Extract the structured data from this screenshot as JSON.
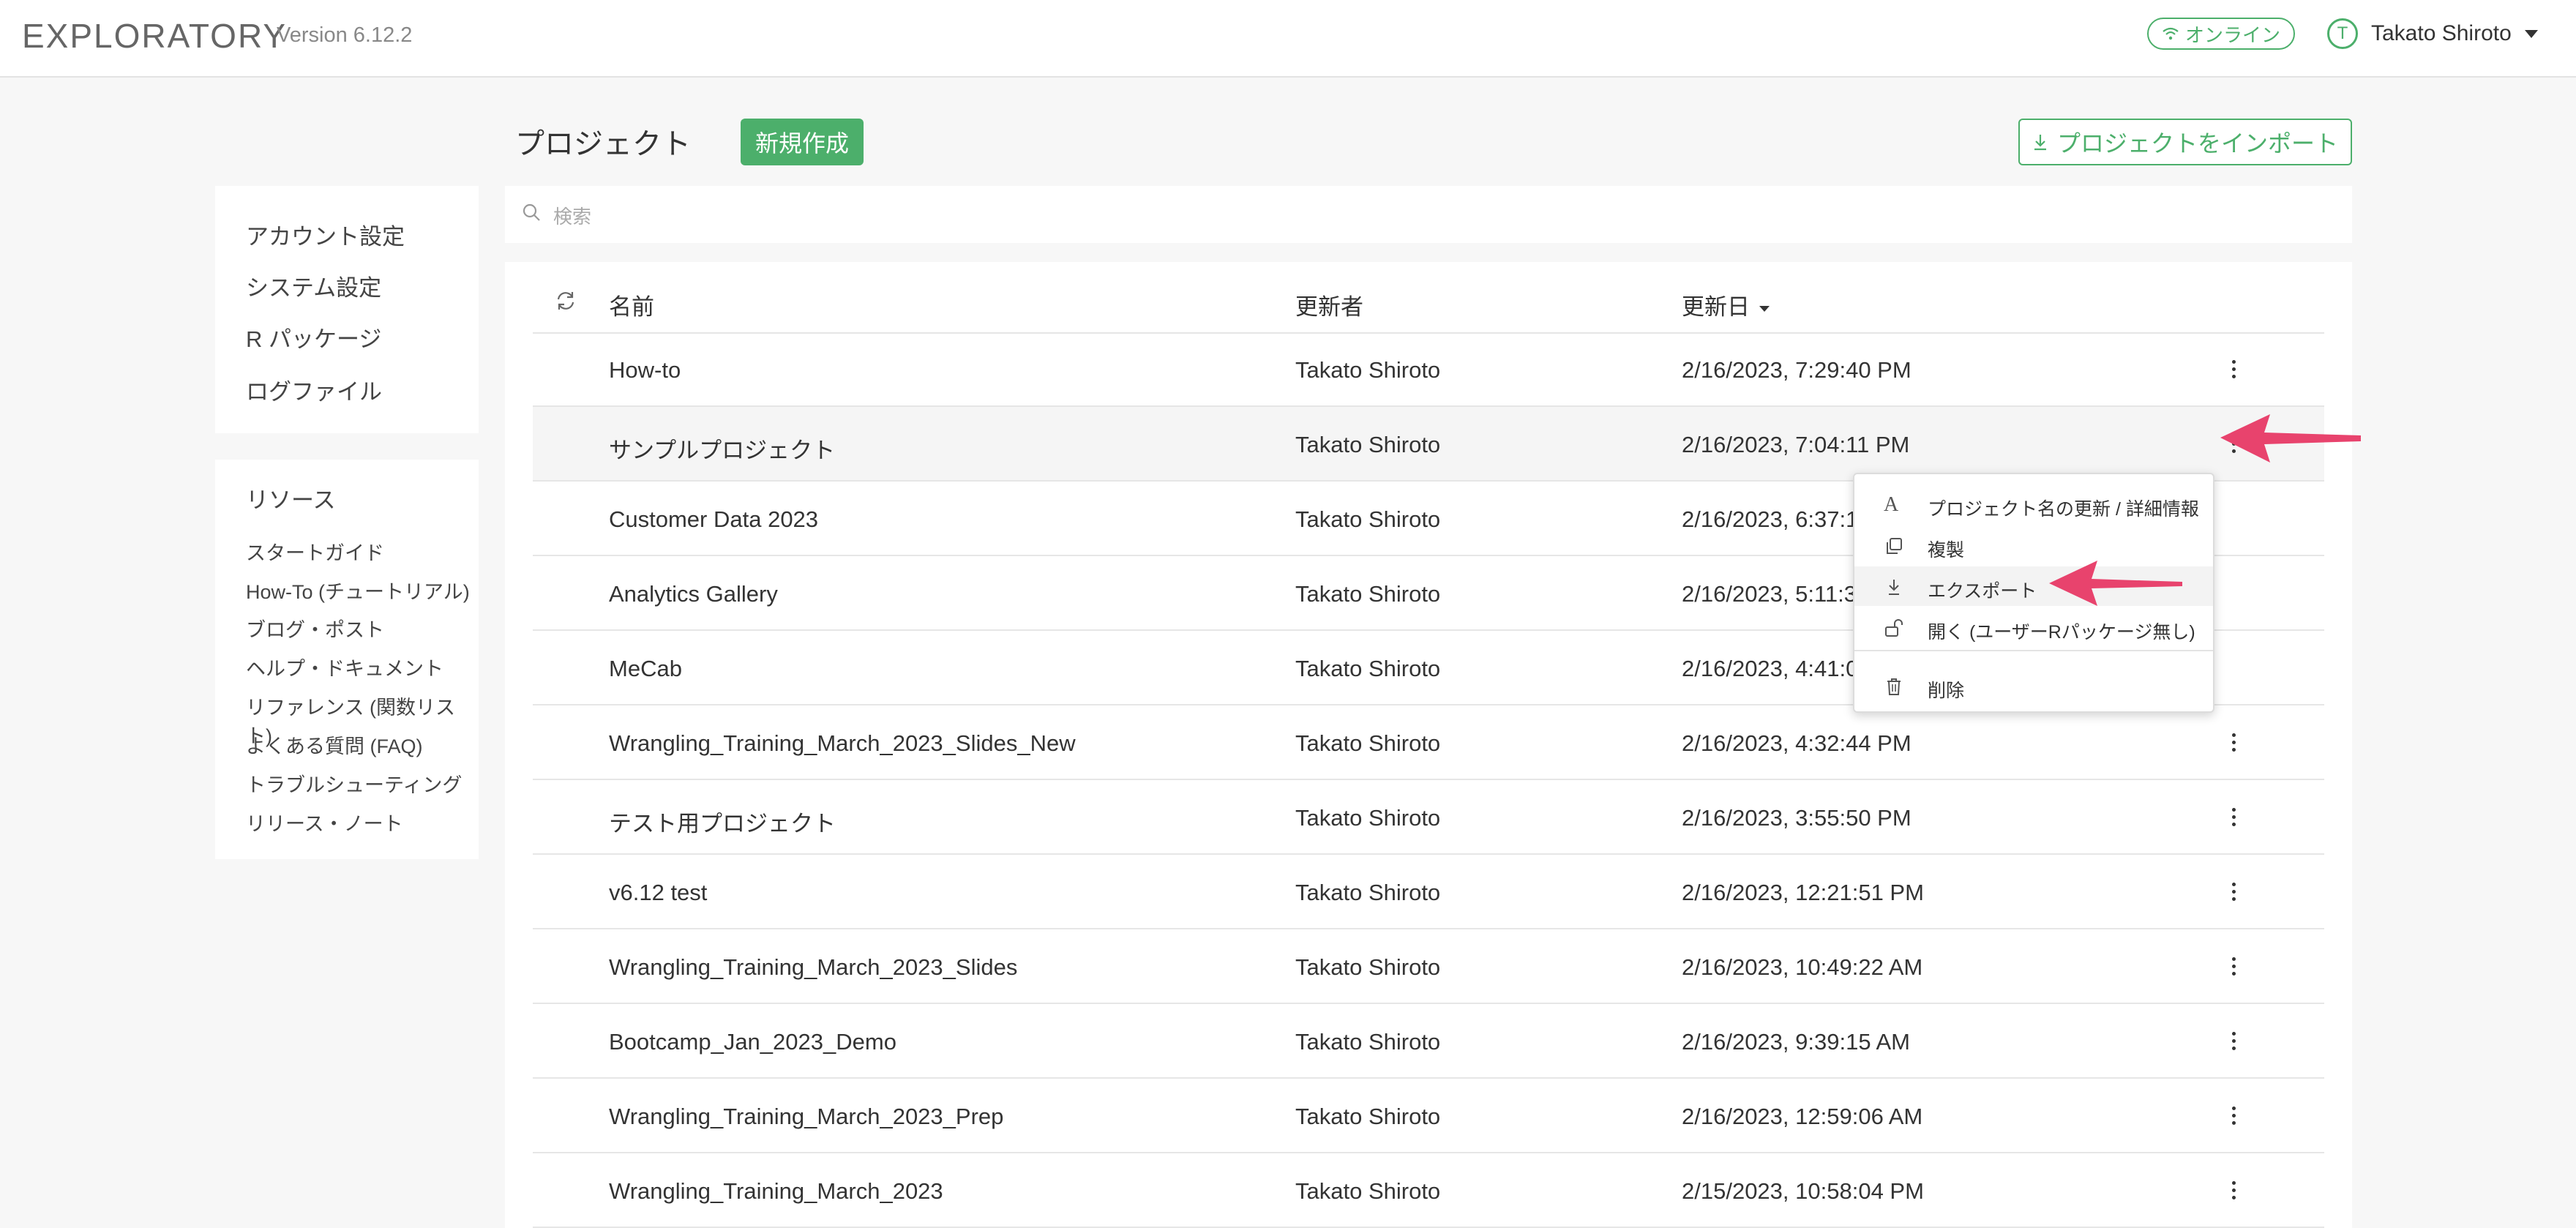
{
  "header": {
    "brand": "EXPLORATORY",
    "version": "Version 6.12.2",
    "online_label": "オンライン",
    "user_initial": "T",
    "user_name": "Takato Shiroto"
  },
  "toolbar": {
    "title": "プロジェクト",
    "new_label": "新規作成",
    "import_label": "プロジェクトをインポート"
  },
  "search": {
    "placeholder": "検索"
  },
  "sidebar": {
    "settings": [
      "アカウント設定",
      "システム設定",
      "R パッケージ",
      "ログファイル"
    ],
    "resources_heading": "リソース",
    "resources": [
      "スタートガイド",
      "How-To (チュートリアル)",
      "ブログ・ポスト",
      "ヘルプ・ドキュメント",
      "リファレンス (関数リスト)",
      "よくある質問 (FAQ)",
      "トラブルシューティング",
      "リリース・ノート"
    ]
  },
  "table": {
    "headers": {
      "name": "名前",
      "owner": "更新者",
      "date": "更新日"
    },
    "rows": [
      {
        "name": "How-to",
        "owner": "Takato Shiroto",
        "date": "2/16/2023, 7:29:40 PM"
      },
      {
        "name": "サンプルプロジェクト",
        "owner": "Takato Shiroto",
        "date": "2/16/2023, 7:04:11 PM"
      },
      {
        "name": "Customer Data 2023",
        "owner": "Takato Shiroto",
        "date": "2/16/2023, 6:37:1"
      },
      {
        "name": "Analytics Gallery",
        "owner": "Takato Shiroto",
        "date": "2/16/2023, 5:11:3"
      },
      {
        "name": "MeCab",
        "owner": "Takato Shiroto",
        "date": "2/16/2023, 4:41:0"
      },
      {
        "name": "Wrangling_Training_March_2023_Slides_New",
        "owner": "Takato Shiroto",
        "date": "2/16/2023, 4:32:44 PM"
      },
      {
        "name": "テスト用プロジェクト",
        "owner": "Takato Shiroto",
        "date": "2/16/2023, 3:55:50 PM"
      },
      {
        "name": "v6.12 test",
        "owner": "Takato Shiroto",
        "date": "2/16/2023, 12:21:51 PM"
      },
      {
        "name": "Wrangling_Training_March_2023_Slides",
        "owner": "Takato Shiroto",
        "date": "2/16/2023, 10:49:22 AM"
      },
      {
        "name": "Bootcamp_Jan_2023_Demo",
        "owner": "Takato Shiroto",
        "date": "2/16/2023, 9:39:15 AM"
      },
      {
        "name": "Wrangling_Training_March_2023_Prep",
        "owner": "Takato Shiroto",
        "date": "2/16/2023, 12:59:06 AM"
      },
      {
        "name": "Wrangling_Training_March_2023",
        "owner": "Takato Shiroto",
        "date": "2/15/2023, 10:58:04 PM"
      }
    ]
  },
  "context_menu": {
    "rename": "プロジェクト名の更新 / 詳細情報",
    "duplicate": "複製",
    "export": "エクスポート",
    "open_without_r": "開く (ユーザーRパッケージ無し)",
    "delete": "削除"
  },
  "colors": {
    "accent": "#4caf6b",
    "annotation_arrow": "#e8436d"
  }
}
